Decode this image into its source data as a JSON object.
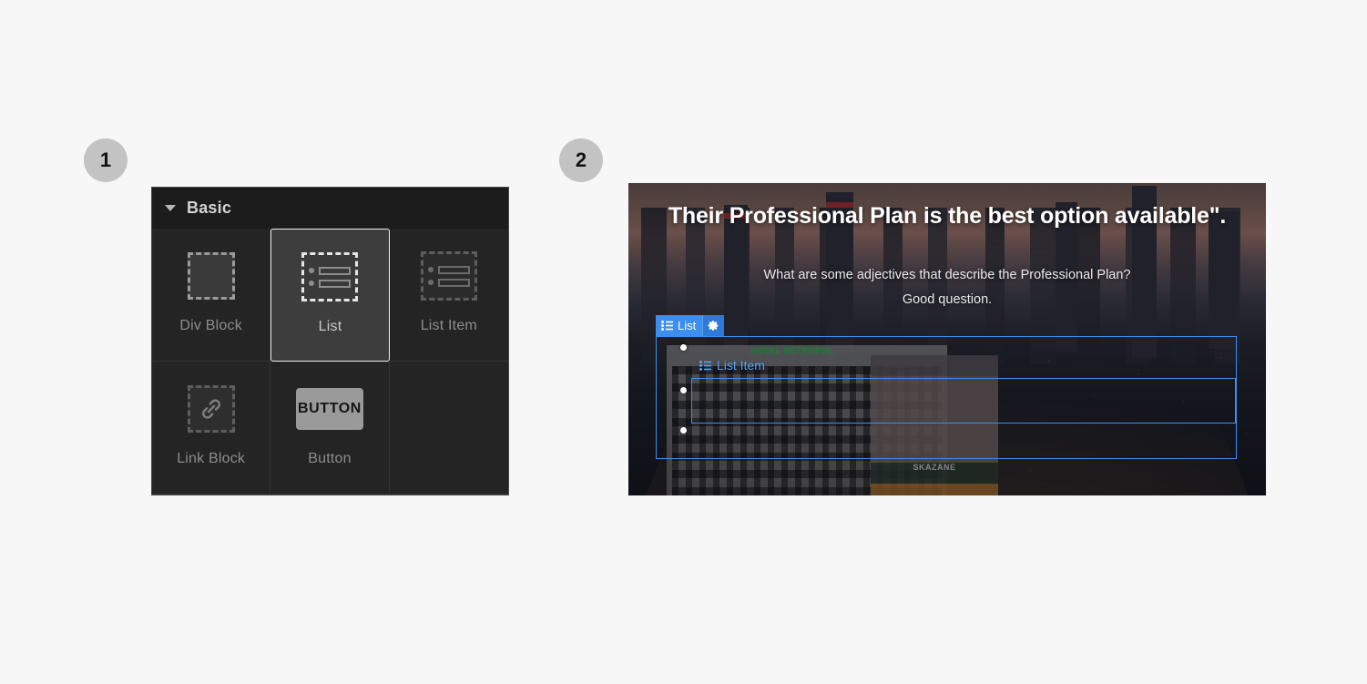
{
  "steps": [
    {
      "number": "1"
    },
    {
      "number": "2"
    }
  ],
  "add_panel": {
    "section_title": "Basic",
    "caret_icon": "caret-down-icon",
    "tiles": [
      {
        "label": "Div Block",
        "icon": "dashed-square-icon",
        "selected": false
      },
      {
        "label": "List",
        "icon": "dashed-list-icon",
        "selected": true
      },
      {
        "label": "List Item",
        "icon": "dashed-list-item-icon",
        "selected": false
      },
      {
        "label": "Link Block",
        "icon": "dashed-link-icon",
        "selected": false
      },
      {
        "label": "Button",
        "icon": "button-chip-icon",
        "selected": false
      },
      {
        "label": "",
        "icon": "",
        "selected": false
      }
    ],
    "button_chip_label": "BUTTON"
  },
  "canvas": {
    "hero_heading": "Their Professional Plan is the best option available\".",
    "hero_paragraph_line1": "What are some adjectives that describe the Professional Plan?",
    "hero_paragraph_line2": "Good question.",
    "selected_tag": {
      "label": "List",
      "list-icon": "list-bullets-icon",
      "gear_icon": "gear-icon"
    },
    "child_tag": {
      "label": "List Item",
      "icon": "list-bullets-icon"
    },
    "background_image": {
      "hotel_sign": "HOTEL METROPOL",
      "billboard_text": "SKAZANE"
    },
    "bullets_count": "3"
  },
  "colors": {
    "page_background": "#f7f7f7",
    "badge_fill": "#c3c3c3",
    "panel_background": "#242424",
    "panel_header_background": "#1c1c1c",
    "tile_selected_background": "#3d3d3d",
    "tile_selected_border": "#f0f0f0",
    "selection_blue": "#3c8ef0",
    "tag_gear_blue": "#2f7ad8",
    "label_grey": "#8d8d8d"
  }
}
